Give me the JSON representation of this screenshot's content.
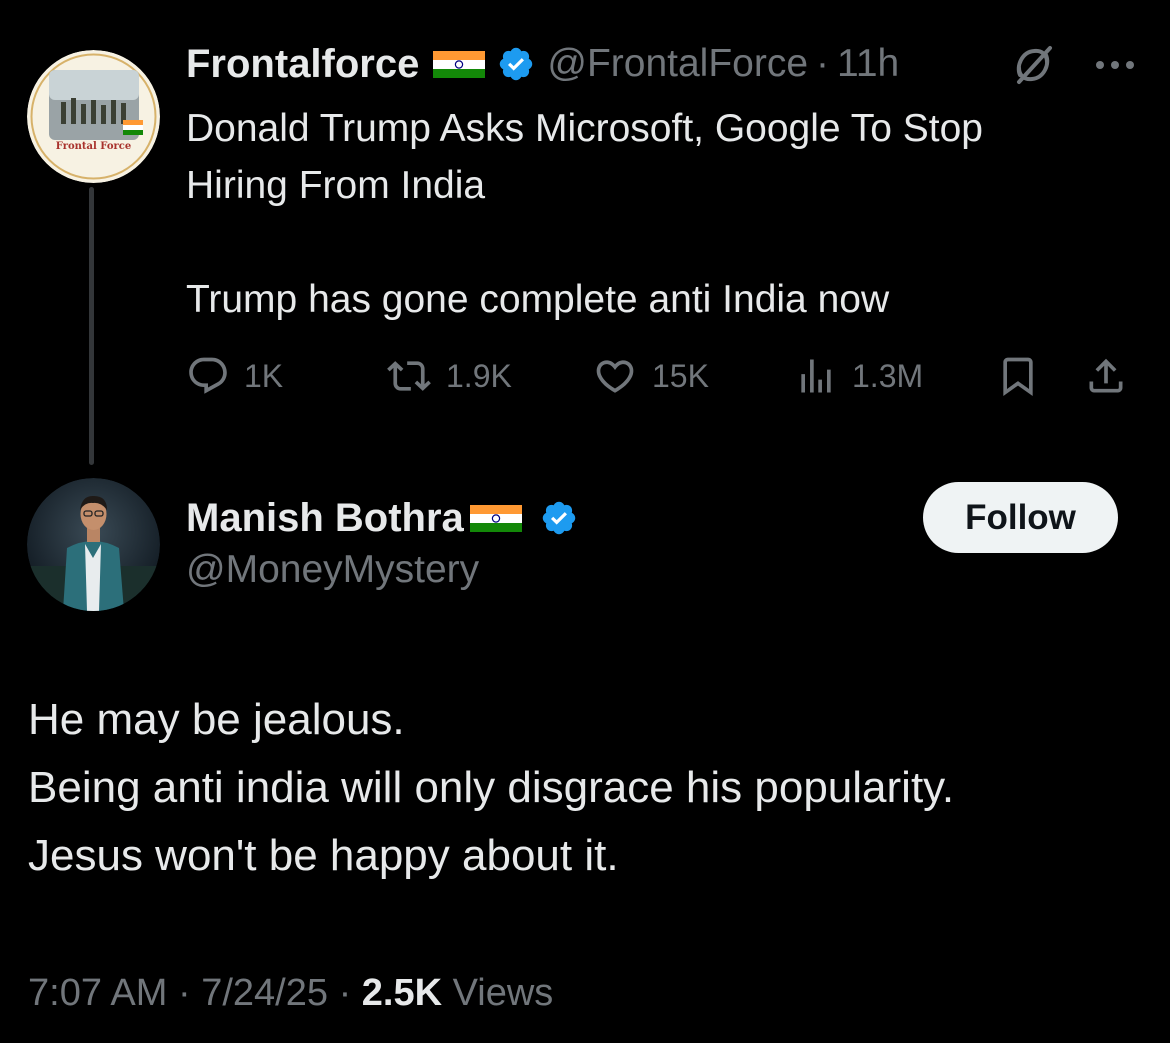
{
  "quoted_tweet": {
    "author_name": "Frontalforce",
    "handle": "@FrontalForce",
    "time": "11h",
    "avatar_caption": "Frontal Force",
    "text": "Donald Trump Asks Microsoft, Google To Stop\nHiring From India\n\nTrump has gone complete anti India now",
    "metrics": {
      "replies": "1K",
      "reposts": "1.9K",
      "likes": "15K",
      "views": "1.3M"
    }
  },
  "reply_tweet": {
    "author_name": "Manish Bothra",
    "handle": "@MoneyMystery",
    "follow_label": "Follow",
    "lines": [
      "He may be jealous.",
      "Being anti india will only disgrace his popularity.",
      "Jesus won't be happy about it."
    ],
    "timestamp": "7:07 AM",
    "date": "7/24/25",
    "views_count": "2.5K",
    "views_label": "Views"
  },
  "colors": {
    "background": "#000000",
    "text_primary": "#e7e9ea",
    "text_secondary": "#71767b",
    "verified_blue": "#1d9bf0",
    "flag_saffron": "#ff9933",
    "flag_green": "#138808",
    "follow_button_bg": "#eff3f4"
  },
  "icons": {
    "verified": "verified-badge-icon",
    "flag": "india-flag-icon",
    "grok": "grok-icon",
    "more": "more-icon",
    "reply": "reply-icon",
    "repost": "repost-icon",
    "like": "heart-icon",
    "views": "views-chart-icon",
    "bookmark": "bookmark-icon",
    "share": "share-icon"
  }
}
